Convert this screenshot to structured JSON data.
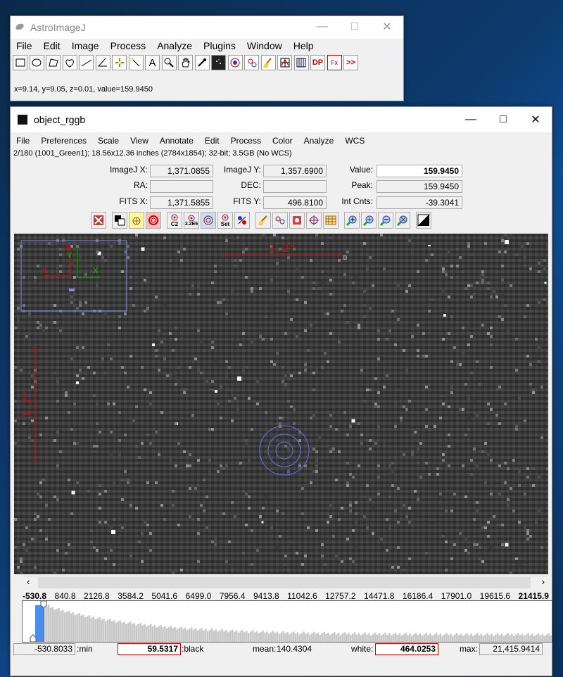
{
  "small_window": {
    "title": "AstroImageJ",
    "menu": [
      "File",
      "Edit",
      "Image",
      "Process",
      "Analyze",
      "Plugins",
      "Window",
      "Help"
    ],
    "status": "x=9.14, y=9.05, z=0.01, value=159.9450",
    "tools": [
      "rectangle-tool-icon",
      "oval-tool-icon",
      "polygon-tool-icon",
      "freehand-tool-icon",
      "line-tool-icon",
      "angle-tool-icon",
      "point-tool-icon",
      "wand-tool-icon",
      "text-tool-icon",
      "magnifier-icon",
      "hand-icon",
      "eyedropper-icon",
      "astro-tool-icon",
      "aperture-tool-icon",
      "multi-aperture-icon",
      "broom-icon",
      "stack-icon",
      "table-icon",
      "dp-icon",
      "fx-icon",
      "more-icon"
    ],
    "dp_label": "DP",
    "fx_label": "Fx",
    "more_label": ">>"
  },
  "image_window": {
    "title": "object_rggb",
    "menu": [
      "File",
      "Preferences",
      "Scale",
      "View",
      "Annotate",
      "Edit",
      "Process",
      "Color",
      "Analyze",
      "WCS"
    ],
    "info": "2/180 (1001_Green1); 18.56x12.36 inches (2784x1854); 32-bit; 3.5GB (No WCS)",
    "fields": {
      "imagej_x_label": "ImageJ X:",
      "imagej_x": "1,371.0855",
      "imagej_y_label": "ImageJ Y:",
      "imagej_y": "1,357.6900",
      "value_label": "Value:",
      "value": "159.9450",
      "ra_label": "RA:",
      "ra": "",
      "dec_label": "DEC:",
      "dec": "",
      "peak_label": "Peak:",
      "peak": "159.9450",
      "fits_x_label": "FITS X:",
      "fits_x": "1,371.5855",
      "fits_y_label": "FITS Y:",
      "fits_y": "496.8100",
      "intcnts_label": "Int Cnts:",
      "intcnts": "-39.3041"
    },
    "icon_labels": {
      "c2": "C2",
      "b2e6": "2.2E6",
      "set": "Set"
    },
    "overlay": {
      "scale_label": "1.2\"",
      "north_label": "N",
      "east_label": "E",
      "x_label": "X",
      "y_label": "Y"
    },
    "histogram": {
      "ticks": [
        "-530.8",
        "840.8",
        "2126.8",
        "3584.2",
        "5041.6",
        "6499.0",
        "7956.4",
        "9413.8",
        "11042.6",
        "12757.2",
        "14471.8",
        "16186.4",
        "17901.0",
        "19615.6",
        "21415.9"
      ],
      "min_value": "-530.8033",
      "min_label": ":min",
      "black_value": "59.5317",
      "black_label": ":black",
      "mean_label": "mean:",
      "mean_value": "140.4304",
      "white_label": "white:",
      "white_value": "464.0253",
      "max_label": "max:",
      "max_value": "21,415.9414"
    }
  }
}
